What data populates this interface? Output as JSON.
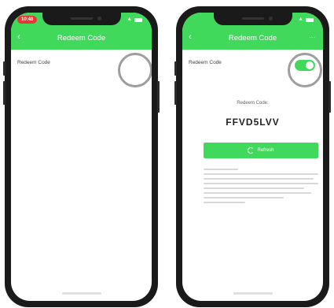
{
  "left_phone": {
    "status": {
      "time": "10:48"
    },
    "header": {
      "back_icon": "chevron-left-icon",
      "title": "Redeem Code"
    },
    "row": {
      "label": "Redeem Code",
      "toggle_on": false
    }
  },
  "right_phone": {
    "header": {
      "back_icon": "chevron-left-icon",
      "title": "Redeem Code",
      "more_icon": "more-icon"
    },
    "row": {
      "label": "Redeem Code",
      "toggle_on": true
    },
    "code_caption": "Redeem Code:",
    "code_value": "FFVD5LVV",
    "action_button": {
      "icon": "refresh-icon",
      "label": "Refresh"
    }
  },
  "colors": {
    "accent": "#41d95b",
    "highlight_ring": "#9e9e9e",
    "time_badge": "#e53935"
  }
}
